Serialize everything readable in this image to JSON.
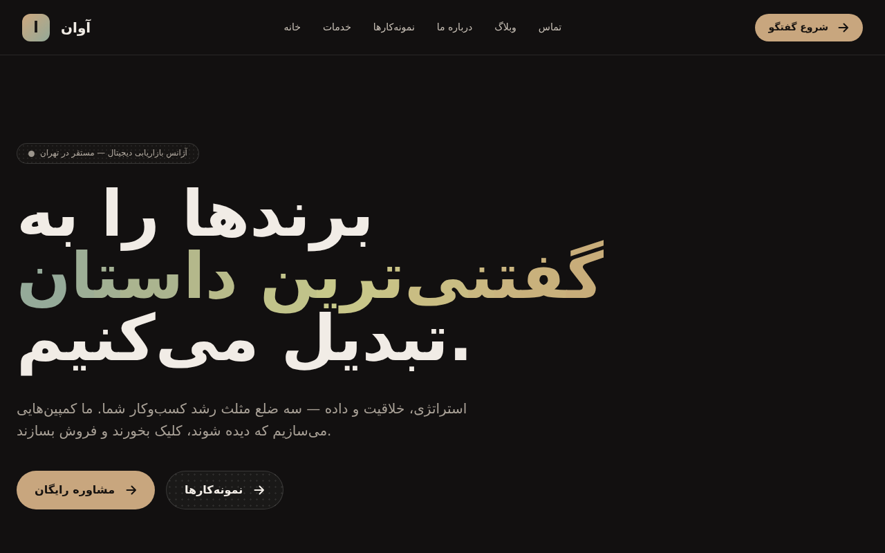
{
  "header": {
    "logo": {
      "letter": "ا",
      "name": "آوان"
    },
    "nav": [
      "تماس",
      "وبلاگ",
      "درباره ما",
      "نمونه‌کارها",
      "خدمات",
      "خانه"
    ],
    "cta": "شروع گفتگو"
  },
  "hero": {
    "badge": "آژانس بازاریابی دیجیتال — مستقر در تهران",
    "headline": [
      {
        "kind": "plain",
        "text": "برندها را به"
      },
      {
        "kind": "gradient",
        "text": "گفتنی‌ترین داستان"
      },
      {
        "kind": "plain",
        "text": "تبدیل می‌کنیم."
      }
    ],
    "lead": "استراتژی، خلاقیت و داده — سه ضلع مثلث رشد کسب‌وکار شما. ما کمپین‌هایی می‌سازیم که دیده شوند، کلیک بخورند و فروش بسازند.",
    "buttons": [
      {
        "kind": "secondary",
        "label": "نمونه‌کارها"
      },
      {
        "kind": "primary",
        "label": "مشاوره رایگان"
      }
    ]
  }
}
